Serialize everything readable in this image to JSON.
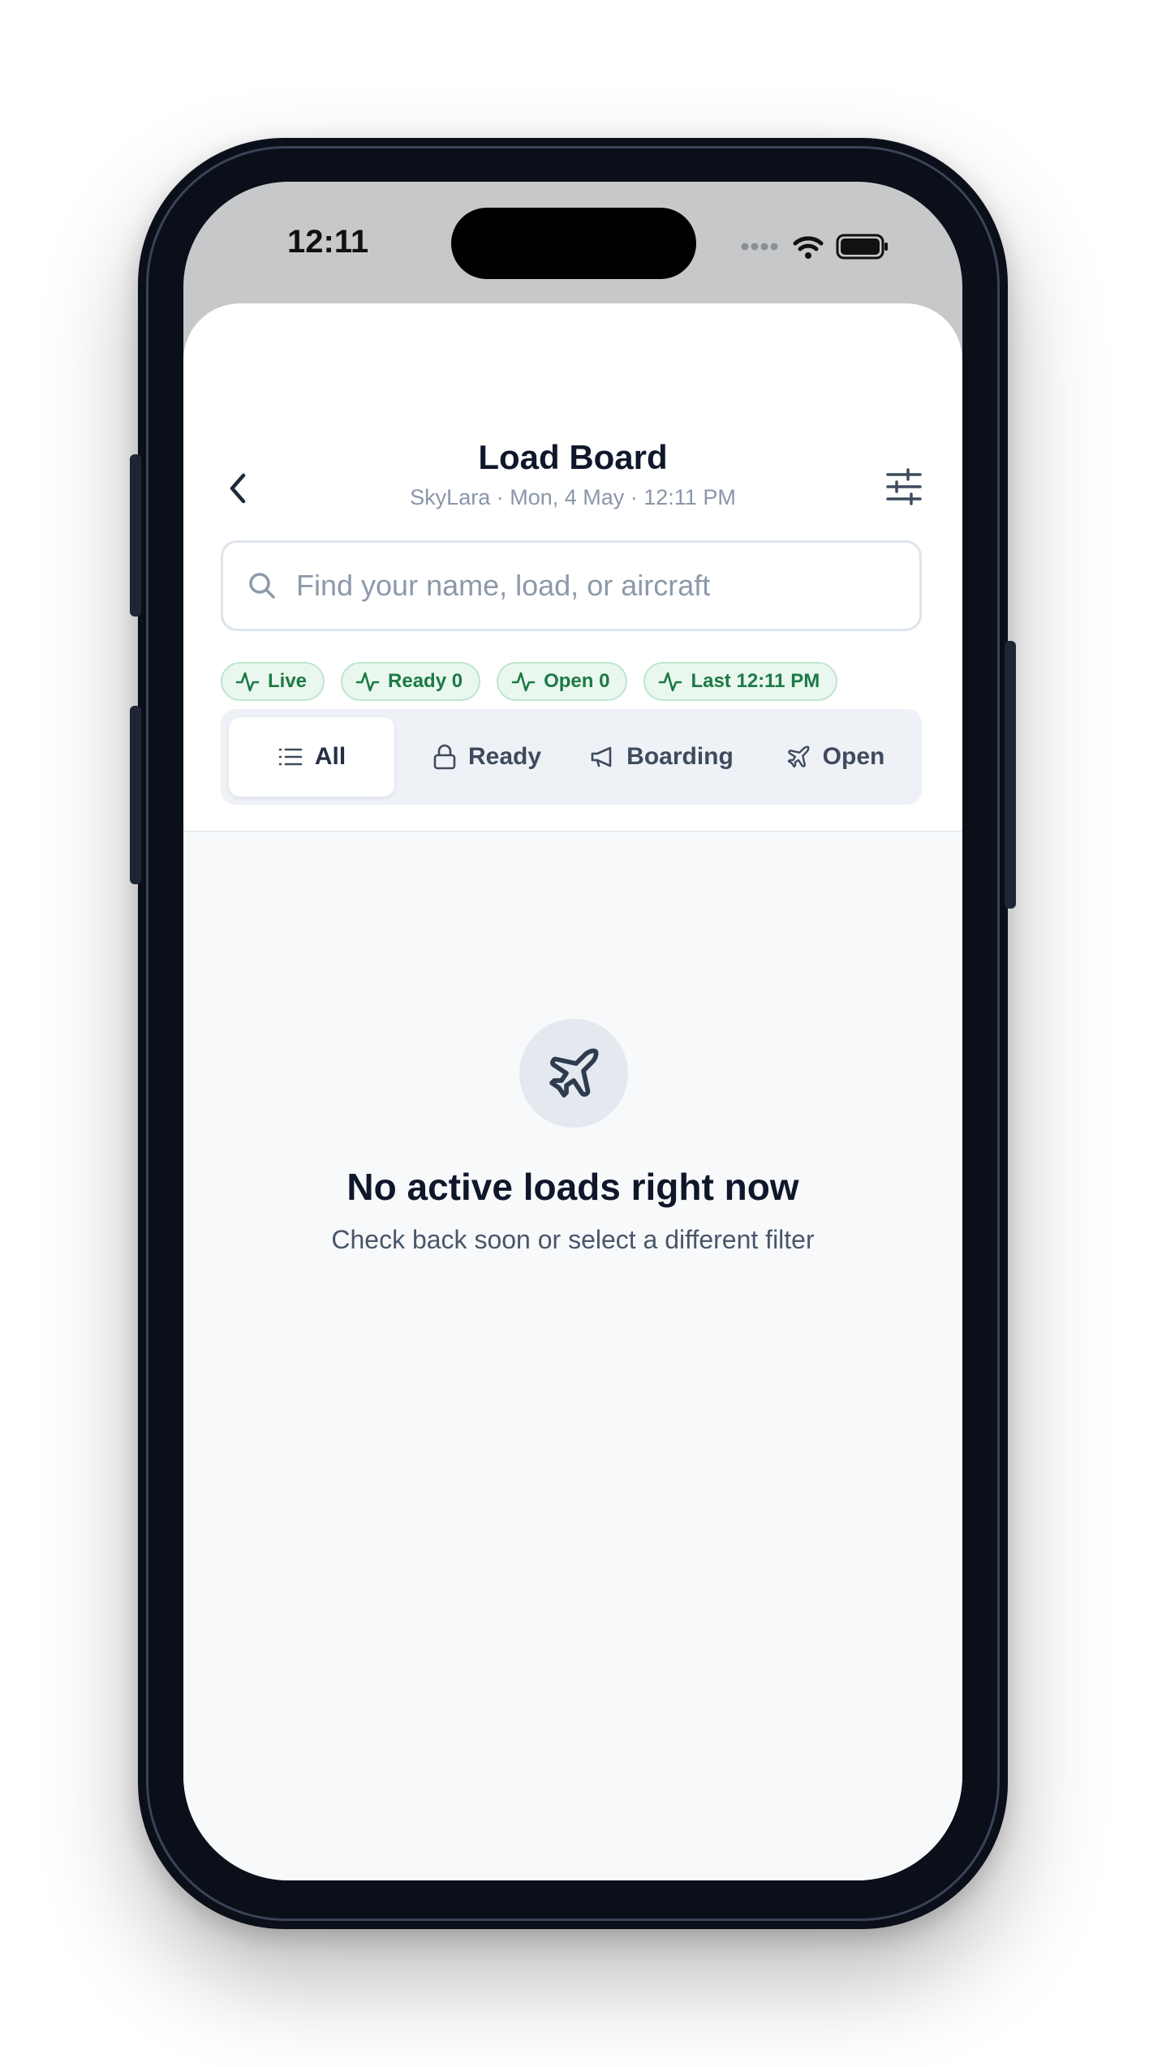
{
  "status_bar": {
    "time": "12:11"
  },
  "header": {
    "title": "Load Board",
    "subtitle": "SkyLara · Mon, 4 May · 12:11 PM",
    "back_icon": "chevron-left-icon",
    "filter_icon": "sliders-icon"
  },
  "search": {
    "placeholder": "Find your name, load, or aircraft",
    "value": ""
  },
  "chips": [
    {
      "label": "Live"
    },
    {
      "label": "Ready 0"
    },
    {
      "label": "Open 0"
    },
    {
      "label": "Last 12:11 PM"
    }
  ],
  "tabs": [
    {
      "label": "All",
      "icon": "list-icon",
      "active": true
    },
    {
      "label": "Ready",
      "icon": "lock-icon",
      "active": false
    },
    {
      "label": "Boarding",
      "icon": "megaphone-icon",
      "active": false
    },
    {
      "label": "Open",
      "icon": "plane-icon",
      "active": false
    }
  ],
  "empty_state": {
    "icon": "plane-icon",
    "title": "No active loads right now",
    "subtitle": "Check back soon or select a different filter"
  },
  "colors": {
    "accent_green": "#1c7a45",
    "chip_bg": "#eaf7ef",
    "text_primary": "#0f172a",
    "text_muted": "#8a96a8"
  }
}
